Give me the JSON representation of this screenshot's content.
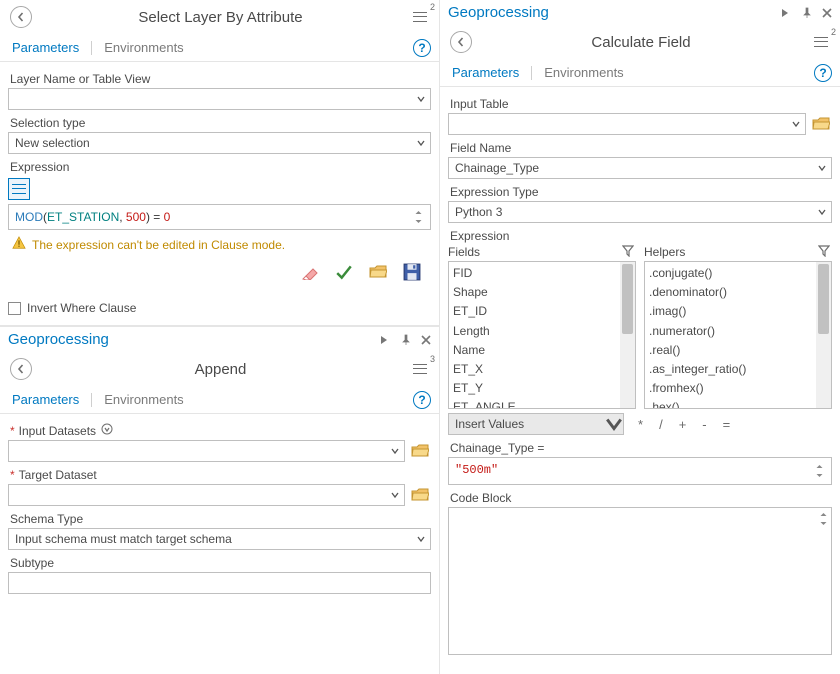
{
  "left": {
    "select_layer": {
      "title": "Select Layer By Attribute",
      "menu_sup": "2",
      "tabs": {
        "parameters": "Parameters",
        "environments": "Environments"
      },
      "layer_label": "Layer Name or Table View",
      "layer_value": "",
      "selection_type_label": "Selection type",
      "selection_type_value": "New selection",
      "expression_label": "Expression",
      "expr_tokens": {
        "fn": "MOD",
        "open": "(",
        "arg1": "ET_STATION",
        "comma": ", ",
        "arg2": "500",
        "close": ")",
        "eq": " = ",
        "zero": "0"
      },
      "warn_text": "The expression can't be edited in Clause mode.",
      "invert_label": "Invert Where Clause"
    },
    "append": {
      "pane_header": "Geoprocessing",
      "title": "Append",
      "menu_sup": "3",
      "tabs": {
        "parameters": "Parameters",
        "environments": "Environments"
      },
      "input_datasets_label": "Input Datasets",
      "target_dataset_label": "Target Dataset",
      "schema_type_label": "Schema Type",
      "schema_type_value": "Input schema must match target schema",
      "subtype_label": "Subtype"
    }
  },
  "right": {
    "pane_header": "Geoprocessing",
    "title": "Calculate Field",
    "menu_sup": "2",
    "tabs": {
      "parameters": "Parameters",
      "environments": "Environments"
    },
    "input_table_label": "Input Table",
    "input_table_value": "",
    "field_name_label": "Field Name",
    "field_name_value": "Chainage_Type",
    "expr_type_label": "Expression Type",
    "expr_type_value": "Python 3",
    "expression_label": "Expression",
    "fields_label": "Fields",
    "helpers_label": "Helpers",
    "fields_items": [
      "FID",
      "Shape",
      "ET_ID",
      "Length",
      "Name",
      "ET_X",
      "ET_Y",
      "ET_ANGLE"
    ],
    "helpers_items": [
      ".conjugate()",
      ".denominator()",
      ".imag()",
      ".numerator()",
      ".real()",
      ".as_integer_ratio()",
      ".fromhex()",
      ".hex()"
    ],
    "insert_values_label": "Insert Values",
    "operators": {
      "mul": "*",
      "div": "/",
      "add": "+",
      "sub": "-",
      "eq": "="
    },
    "chainage_expr_label": "Chainage_Type =",
    "chainage_expr_value": "\"500m\"",
    "code_block_label": "Code Block"
  }
}
